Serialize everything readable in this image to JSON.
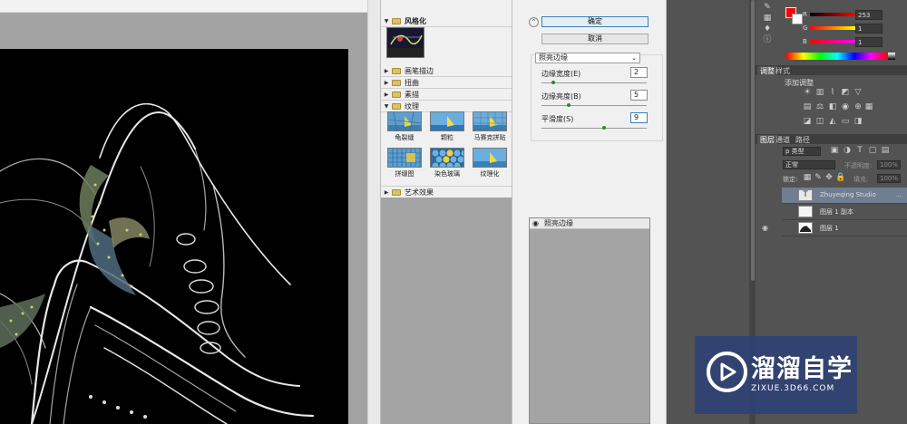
{
  "gallery": {
    "categories": [
      {
        "label": "风格化",
        "expanded": true
      },
      {
        "label": "画笔描边",
        "expanded": false
      },
      {
        "label": "扭曲",
        "expanded": false
      },
      {
        "label": "素描",
        "expanded": false
      },
      {
        "label": "纹理",
        "expanded": true
      },
      {
        "label": "艺术效果",
        "expanded": false
      }
    ],
    "stylize_thumb_label": "照亮边缘",
    "texture_items": [
      "龟裂缝",
      "颗粒",
      "马赛克拼贴",
      "拼缀图",
      "染色玻璃",
      "纹理化"
    ]
  },
  "controls": {
    "ok_label": "确定",
    "cancel_label": "取消",
    "filter_select": "照亮边缘",
    "params": [
      {
        "label": "边缘宽度(E)",
        "value": "2",
        "slider": 0.1
      },
      {
        "label": "边缘亮度(B)",
        "value": "5",
        "slider": 0.25
      },
      {
        "label": "平滑度(S)",
        "value": "9",
        "slider": 0.6
      }
    ],
    "applied_filter": "照亮边缘"
  },
  "colors_panel": {
    "channels": [
      {
        "label": "R",
        "value": "253",
        "color": "#e02020"
      },
      {
        "label": "G",
        "value": "1",
        "color": "#20c020"
      },
      {
        "label": "B",
        "value": "1",
        "color": "#2020e0"
      }
    ]
  },
  "adjustments_panel": {
    "tabs": [
      "调整",
      "样式"
    ],
    "title": "添加调整"
  },
  "layers_panel": {
    "tabs": [
      "图层",
      "通道",
      "路径"
    ],
    "filter_label": "p 类型",
    "blend_mode": "正常",
    "opacity_label": "不透明度:",
    "opacity_value": "100%",
    "lock_label": "锁定:",
    "fill_label": "填充:",
    "fill_value": "100%",
    "layers": [
      {
        "name": "Zhuyeqing Studio",
        "kind": "text",
        "selected": true
      },
      {
        "name": "图层 1 副本",
        "kind": "image",
        "selected": false
      },
      {
        "name": "图层 1",
        "kind": "image",
        "selected": false
      }
    ]
  },
  "watermark": {
    "title": "溜溜自学",
    "subtitle": "ZIXUE.3D66.COM"
  },
  "colors": {
    "ok_border": "#3c7fb1",
    "layer_selected": "#6f7e90",
    "watermark_bg": "#2c4078",
    "foreground_swatch": "#ff0000"
  }
}
